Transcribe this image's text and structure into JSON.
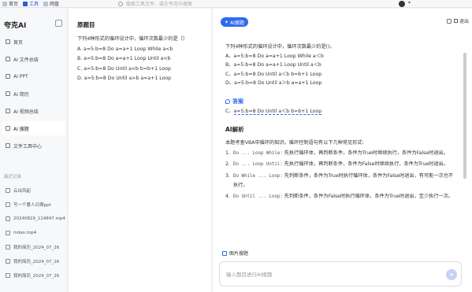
{
  "topbar": {
    "tabs": [
      {
        "label": "首页",
        "icon": "home-icon"
      },
      {
        "label": "工具",
        "icon": "tools-icon",
        "active": true
      },
      {
        "label": "网盘",
        "icon": "cloud-drive-icon"
      }
    ],
    "search_placeholder": "搜索工具文件、或在夸克中搜索"
  },
  "sidebar": {
    "brand": "夸克AI",
    "nav": [
      {
        "label": "首页"
      },
      {
        "label": "AI 文件总结"
      },
      {
        "label": "AI PPT"
      },
      {
        "label": "AI 简历"
      },
      {
        "label": "AI 视频总结"
      },
      {
        "label": "AI 搜题",
        "active": true
      },
      {
        "label": "文件工具中心"
      }
    ],
    "history_title": "最近记录",
    "history": [
      {
        "label": "云出风起"
      },
      {
        "label": "写一个寡人日期ppt"
      },
      {
        "label": "20240829_114847.mp4"
      },
      {
        "label": "index.mp4"
      },
      {
        "label": "我的简历_2024_07_26"
      },
      {
        "label": "我的简历_2024_07_26"
      },
      {
        "label": "我的简历_2024_07_26"
      }
    ]
  },
  "question": {
    "title": "原题目",
    "lines": [
      "下列4种形式的循环设计中，循环次数最少的是（）",
      "A. a=5:b=8 Do a=a+1 Loop While a<b",
      "B. a=5:b=8 Do a=a+1 Loop Until a<b",
      "C. a=5:b=8 Do Until a<b b=b+1 Loop",
      "D. a=5:b=8 Do Until a>b a=a+1 Loop"
    ]
  },
  "ai": {
    "pill": "AI搜题",
    "exit": "退出",
    "question_lines": [
      "下列4种形式的循环设计中，循环次数最少的是()。",
      "A、a=5:b=8 Do a=a+1 Loop While a＜b",
      "B、a=5:b=8 Do a=a+1 Loop Until a＜b",
      "C、a=5:b=8 Do Until a＜b b=b+1 Loop",
      "D、a=5:b=8 Do Until a＞b a=a+1 Loop"
    ],
    "answer_label": "答案",
    "answer_prefix": "C、",
    "answer_value": "a=5:b=8 Do Until a＜b b=b+1 Loop",
    "analysis_title": "AI解析",
    "analysis_intro": "本题考查VBA中循环的知识。循环控制语句有以下几种常见形式:",
    "analysis_items": [
      {
        "num": "1.",
        "code": "Do ... Loop While:",
        "text": " 先执行循环体，再判断条件，条件为True时继续执行，条件为False时退出。"
      },
      {
        "num": "2.",
        "code": "Do ... Loop Until:",
        "text": " 先执行循环体，再判断条件，条件为False时继续执行，条件为True时退出。"
      },
      {
        "num": "3.",
        "code": "Do While ... Loop:",
        "text": " 先判断条件，条件为True时执行循环体，条件为False时退出，有可能一次也不执行。"
      },
      {
        "num": "4.",
        "code": "Do Until ... Loop:",
        "text": " 先判断条件，条件为False时执行循环体，条件为True时退出，至少执行一次。"
      }
    ],
    "image_search": "图片搜题",
    "input_placeholder": "输入题目进行AI搜题",
    "accent": "#2f6bf0"
  }
}
